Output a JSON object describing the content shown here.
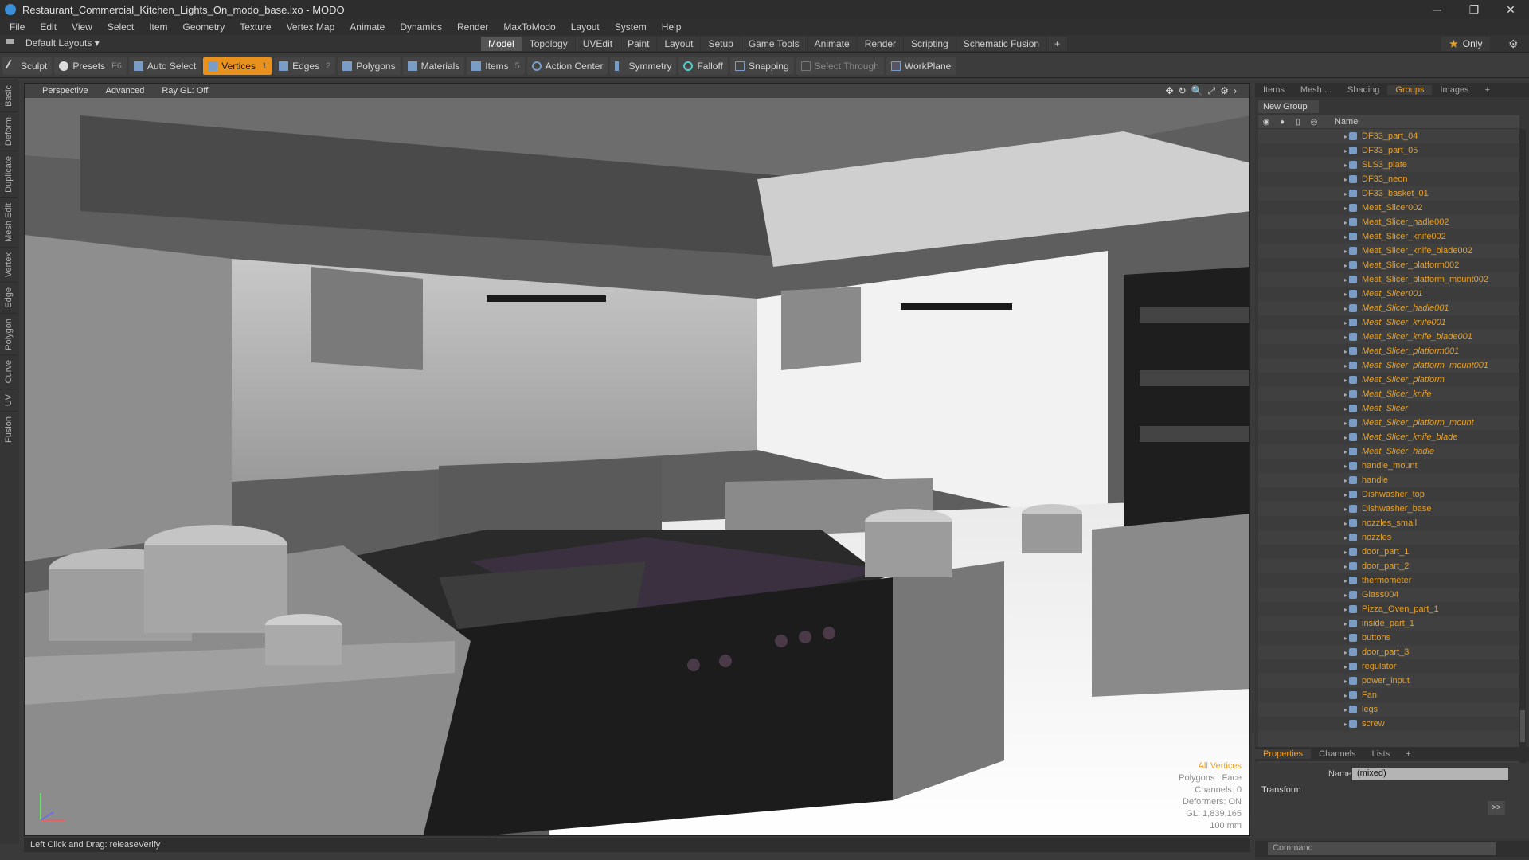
{
  "window": {
    "title": "Restaurant_Commercial_Kitchen_Lights_On_modo_base.lxo - MODO",
    "controls": [
      "─",
      "❐",
      "✕"
    ]
  },
  "menu": [
    "File",
    "Edit",
    "View",
    "Select",
    "Item",
    "Geometry",
    "Texture",
    "Vertex Map",
    "Animate",
    "Dynamics",
    "Render",
    "MaxToModo",
    "Layout",
    "System",
    "Help"
  ],
  "layout_selector": "Default Layouts ▾",
  "mode_tabs": [
    "Model",
    "Topology",
    "UVEdit",
    "Paint",
    "Layout",
    "Setup",
    "Game Tools",
    "Animate",
    "Render",
    "Scripting",
    "Schematic Fusion",
    "+"
  ],
  "only_label": "Only",
  "toolbar": {
    "sculpt": "Sculpt",
    "presets": "Presets",
    "presets_key": "F6",
    "auto_select": "Auto Select",
    "vertices": "Vertices",
    "vertices_key": "1",
    "edges": "Edges",
    "edges_key": "2",
    "polygons": "Polygons",
    "materials": "Materials",
    "items": "Items",
    "items_key": "5",
    "action_center": "Action Center",
    "symmetry": "Symmetry",
    "falloff": "Falloff",
    "snapping": "Snapping",
    "select_through": "Select Through",
    "workplane": "WorkPlane"
  },
  "left_tabs": [
    "Basic",
    "Deform",
    "Duplicate",
    "Mesh Edit",
    "Vertex",
    "Edge",
    "Polygon",
    "Curve",
    "UV",
    "Fusion"
  ],
  "viewport": {
    "view": "Perspective",
    "mode": "Advanced",
    "raygl": "Ray GL: Off",
    "info": [
      "All Vertices",
      "Polygons : Face",
      "Channels: 0",
      "Deformers: ON",
      "GL: 1,839,165",
      "100 mm"
    ]
  },
  "status": "Left Click and Drag:   releaseVerify",
  "right_tabs": [
    "Items",
    "Mesh ...",
    "Shading",
    "Groups",
    "Images",
    "+"
  ],
  "new_group": "New Group",
  "list_header": "Name",
  "items": [
    {
      "name": "DF33_part_04",
      "italic": false
    },
    {
      "name": "DF33_part_05",
      "italic": false
    },
    {
      "name": "SLS3_plate",
      "italic": false
    },
    {
      "name": "DF33_neon",
      "italic": false
    },
    {
      "name": "DF33_basket_01",
      "italic": false
    },
    {
      "name": "Meat_Slicer002",
      "italic": false
    },
    {
      "name": "Meat_Slicer_hadle002",
      "italic": false
    },
    {
      "name": "Meat_Slicer_knife002",
      "italic": false
    },
    {
      "name": "Meat_Slicer_knife_blade002",
      "italic": false
    },
    {
      "name": "Meat_Slicer_platform002",
      "italic": false
    },
    {
      "name": "Meat_Slicer_platform_mount002",
      "italic": false
    },
    {
      "name": "Meat_Slicer001",
      "italic": true
    },
    {
      "name": "Meat_Slicer_hadle001",
      "italic": true
    },
    {
      "name": "Meat_Slicer_knife001",
      "italic": true
    },
    {
      "name": "Meat_Slicer_knife_blade001",
      "italic": true
    },
    {
      "name": "Meat_Slicer_platform001",
      "italic": true
    },
    {
      "name": "Meat_Slicer_platform_mount001",
      "italic": true
    },
    {
      "name": "Meat_Slicer_platform",
      "italic": true
    },
    {
      "name": "Meat_Slicer_knife",
      "italic": true
    },
    {
      "name": "Meat_Slicer",
      "italic": true
    },
    {
      "name": "Meat_Slicer_platform_mount",
      "italic": true
    },
    {
      "name": "Meat_Slicer_knife_blade",
      "italic": true
    },
    {
      "name": "Meat_Slicer_hadle",
      "italic": true
    },
    {
      "name": "handle_mount",
      "italic": false
    },
    {
      "name": "handle",
      "italic": false
    },
    {
      "name": "Dishwasher_top",
      "italic": false
    },
    {
      "name": "Dishwasher_base",
      "italic": false
    },
    {
      "name": "nozzles_small",
      "italic": false
    },
    {
      "name": "nozzles",
      "italic": false
    },
    {
      "name": "door_part_1",
      "italic": false
    },
    {
      "name": "door_part_2",
      "italic": false
    },
    {
      "name": "thermometer",
      "italic": false
    },
    {
      "name": "Glass004",
      "italic": false
    },
    {
      "name": "Pizza_Oven_part_1",
      "italic": false
    },
    {
      "name": "inside_part_1",
      "italic": false
    },
    {
      "name": "buttons",
      "italic": false
    },
    {
      "name": "door_part_3",
      "italic": false
    },
    {
      "name": "regulator",
      "italic": false
    },
    {
      "name": "power_input",
      "italic": false
    },
    {
      "name": "Fan",
      "italic": false
    },
    {
      "name": "legs",
      "italic": false
    },
    {
      "name": "screw",
      "italic": false
    }
  ],
  "prop_tabs": [
    "Properties",
    "Channels",
    "Lists",
    "+"
  ],
  "properties": {
    "name_label": "Name",
    "name_value": "(mixed)",
    "section": "Transform",
    "arrow": ">>"
  },
  "command_placeholder": "Command",
  "colors": {
    "accent": "#f0a020",
    "item_text": "#e8a020",
    "active_tool": "#e8921d"
  }
}
